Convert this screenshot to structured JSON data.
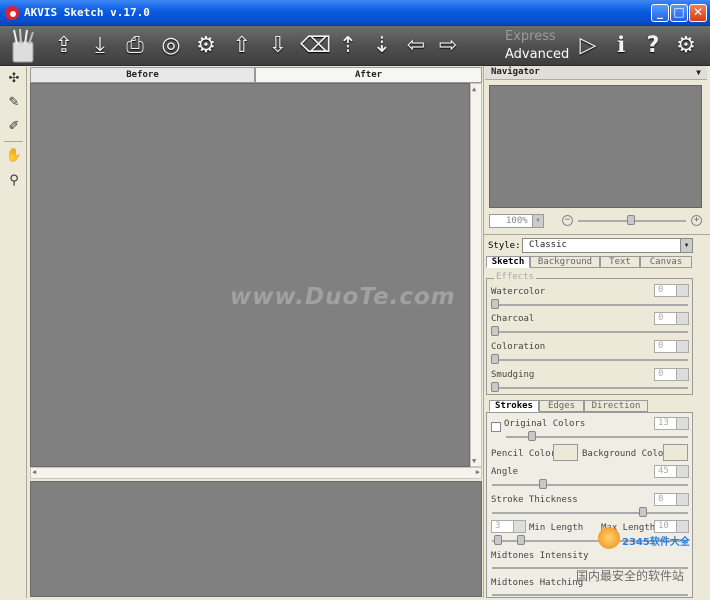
{
  "window": {
    "title": "AKVIS Sketch v.17.0",
    "minimize": "_",
    "maximize": "□",
    "close": "✕"
  },
  "toolbar": {
    "buttons": [
      "open",
      "save",
      "print",
      "batch",
      "settings-plugin",
      "upload-settings",
      "download-settings",
      "erase",
      "apply-up",
      "apply-down",
      "undo",
      "redo"
    ],
    "mode_express": "Express",
    "mode_advanced": "Advanced"
  },
  "canvas_tabs": {
    "before": "Before",
    "after": "After"
  },
  "watermark": "www.DuoTe.com",
  "navigator": {
    "title": "Navigator",
    "zoom": "100%"
  },
  "style": {
    "label": "Style:",
    "value": "Classic"
  },
  "tabs": [
    "Sketch",
    "Background",
    "Text",
    "Canvas"
  ],
  "effects": {
    "group_title": "Effects",
    "items": [
      {
        "label": "Watercolor",
        "value": "0"
      },
      {
        "label": "Charcoal",
        "value": "0"
      },
      {
        "label": "Coloration",
        "value": "0"
      },
      {
        "label": "Smudging",
        "value": "0"
      }
    ]
  },
  "stroke_tabs": [
    "Strokes",
    "Edges",
    "Direction"
  ],
  "strokes": {
    "original_colors": "Original Colors",
    "original_colors_value": "13",
    "pencil_color": "Pencil Color",
    "background_color": "Background Color",
    "angle": "Angle",
    "angle_value": "45",
    "stroke_thickness": "Stroke Thickness",
    "stroke_thickness_value": "8",
    "min_length_value": "3",
    "min_length": "Min Length",
    "max_length": "Max Length",
    "max_length_value": "10",
    "midtones_intensity": "Midtones Intensity",
    "midtones_hatching": "Midtones Hatching"
  },
  "site_watermark": "2345软件大全",
  "site_watermark_sub": "国内最安全的软件站"
}
